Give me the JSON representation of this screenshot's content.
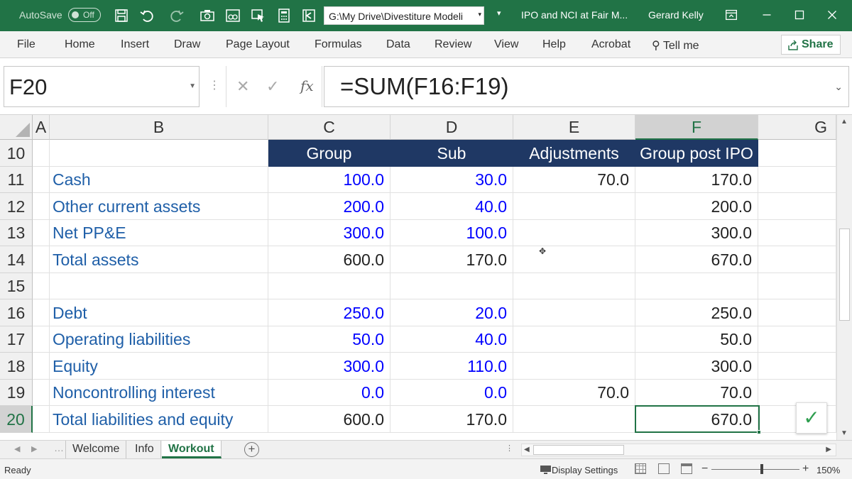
{
  "titlebar": {
    "autosave_label": "AutoSave",
    "autosave_state": "Off",
    "file_path": "G:\\My Drive\\Divestiture Modeli",
    "document_title": "IPO and NCI at Fair M...",
    "user_name": "Gerard Kelly"
  },
  "ribbon": {
    "tabs": [
      "File",
      "Home",
      "Insert",
      "Draw",
      "Page Layout",
      "Formulas",
      "Data",
      "Review",
      "View",
      "Help",
      "Acrobat"
    ],
    "tell_me": "Tell me",
    "share": "Share"
  },
  "formula_bar": {
    "name_box": "F20",
    "fx_label": "fx",
    "formula": "=SUM(F16:F19)"
  },
  "columns": [
    "A",
    "B",
    "C",
    "D",
    "E",
    "F",
    "G"
  ],
  "selected_column": "F",
  "rows": [
    {
      "num": "10",
      "b": "",
      "c": "Group",
      "d": "Sub",
      "e": "Adjustments",
      "f": "Group post IPO"
    },
    {
      "num": "11",
      "b": "Cash",
      "c": "100.0",
      "d": "30.0",
      "e": "70.0",
      "f": "170.0"
    },
    {
      "num": "12",
      "b": "Other current assets",
      "c": "200.0",
      "d": "40.0",
      "e": "",
      "f": "200.0"
    },
    {
      "num": "13",
      "b": "Net PP&E",
      "c": "300.0",
      "d": "100.0",
      "e": "",
      "f": "300.0"
    },
    {
      "num": "14",
      "b": "Total assets",
      "c": "600.0",
      "d": "170.0",
      "e": "",
      "f": "670.0"
    },
    {
      "num": "15",
      "b": "",
      "c": "",
      "d": "",
      "e": "",
      "f": ""
    },
    {
      "num": "16",
      "b": "Debt",
      "c": "250.0",
      "d": "20.0",
      "e": "",
      "f": "250.0"
    },
    {
      "num": "17",
      "b": "Operating liabilities",
      "c": "50.0",
      "d": "40.0",
      "e": "",
      "f": "50.0"
    },
    {
      "num": "18",
      "b": "Equity",
      "c": "300.0",
      "d": "110.0",
      "e": "",
      "f": "300.0"
    },
    {
      "num": "19",
      "b": "Noncontrolling interest",
      "c": "0.0",
      "d": "0.0",
      "e": "70.0",
      "f": "70.0"
    },
    {
      "num": "20",
      "b": "Total liabilities and equity",
      "c": "600.0",
      "d": "170.0",
      "e": "",
      "f": "670.0"
    }
  ],
  "selected_row": "20",
  "sheets": {
    "tabs": [
      "Welcome",
      "Info",
      "Workout"
    ],
    "active": "Workout"
  },
  "status": {
    "ready": "Ready",
    "display_settings": "Display Settings",
    "zoom": "150%"
  },
  "colors": {
    "excel_green": "#217346",
    "header_navy": "#1f3864",
    "input_blue": "#0000ff",
    "label_blue": "#1f5fa8"
  }
}
